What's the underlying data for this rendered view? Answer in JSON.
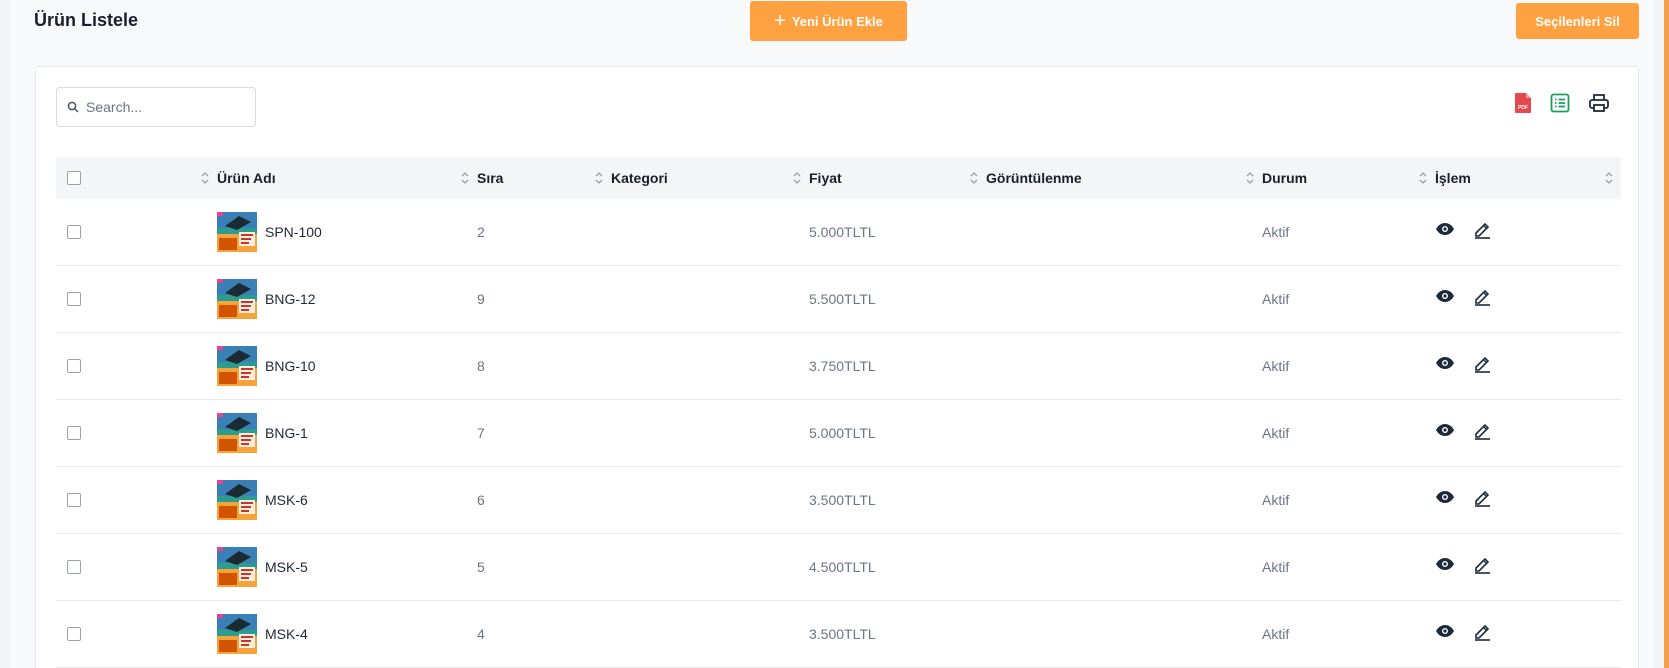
{
  "header": {
    "title": "Ürün Listele",
    "add_button": "Yeni Ürün Ekle",
    "delete_selected_button": "Seçilenleri Sil"
  },
  "search": {
    "placeholder": "Search..."
  },
  "toolbar": {
    "icons": [
      "pdf-export-icon",
      "excel-export-icon",
      "print-icon"
    ]
  },
  "table": {
    "columns": [
      "",
      "Ürün Adı",
      "Sıra",
      "Kategori",
      "Fiyat",
      "Görüntülenme",
      "Durum",
      "İşlem"
    ],
    "rows": [
      {
        "name": "SPN-100",
        "order": "2",
        "category": "",
        "price": "5.000TLTL",
        "views": "",
        "status": "Aktif"
      },
      {
        "name": "BNG-12",
        "order": "9",
        "category": "",
        "price": "5.500TLTL",
        "views": "",
        "status": "Aktif"
      },
      {
        "name": "BNG-10",
        "order": "8",
        "category": "",
        "price": "3.750TLTL",
        "views": "",
        "status": "Aktif"
      },
      {
        "name": "BNG-1",
        "order": "7",
        "category": "",
        "price": "5.000TLTL",
        "views": "",
        "status": "Aktif"
      },
      {
        "name": "MSK-6",
        "order": "6",
        "category": "",
        "price": "3.500TLTL",
        "views": "",
        "status": "Aktif"
      },
      {
        "name": "MSK-5",
        "order": "5",
        "category": "",
        "price": "4.500TLTL",
        "views": "",
        "status": "Aktif"
      },
      {
        "name": "MSK-4",
        "order": "4",
        "category": "",
        "price": "3.500TLTL",
        "views": "",
        "status": "Aktif"
      }
    ]
  },
  "colors": {
    "accent": "#ffa140",
    "pdf": "#e5484d",
    "excel": "#1aa05a",
    "icon_dark": "#1e2a3a"
  }
}
